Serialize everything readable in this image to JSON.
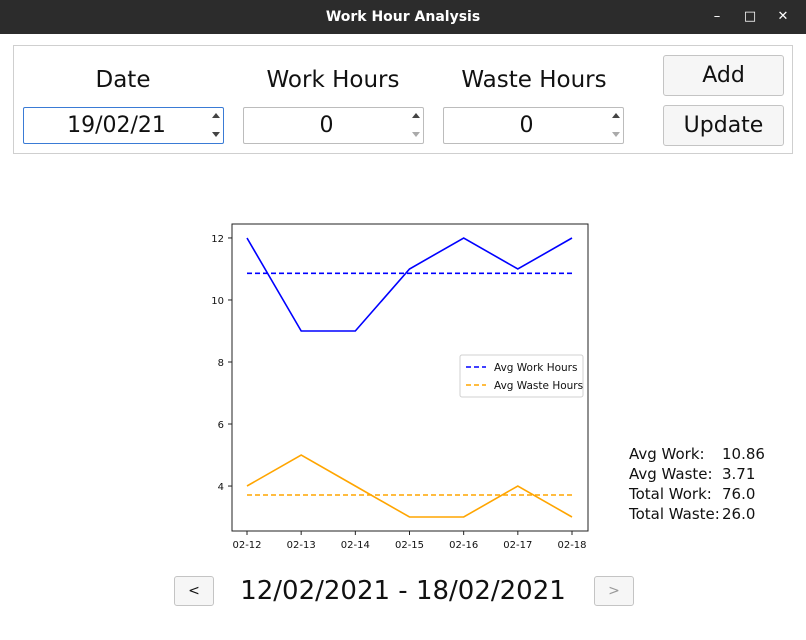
{
  "window": {
    "title": "Work Hour Analysis",
    "minimize": "–",
    "maximize": "□",
    "close": "✕"
  },
  "form": {
    "date_label": "Date",
    "work_label": "Work Hours",
    "waste_label": "Waste Hours",
    "date_value": "19/02/21",
    "work_value": "0",
    "waste_value": "0",
    "add_label": "Add",
    "update_label": "Update"
  },
  "chart_data": {
    "type": "line",
    "categories": [
      "02-12",
      "02-13",
      "02-14",
      "02-15",
      "02-16",
      "02-17",
      "02-18"
    ],
    "series": [
      {
        "name": "",
        "color": "#0000ff",
        "style": "solid",
        "values": [
          12,
          9,
          9,
          11,
          12,
          11,
          12
        ]
      },
      {
        "name": "",
        "color": "#ffa500",
        "style": "solid",
        "values": [
          4,
          5,
          4,
          3,
          3,
          4,
          3
        ]
      },
      {
        "name": "Avg Work Hours",
        "color": "#0000ff",
        "style": "dashed",
        "values": [
          10.86,
          10.86,
          10.86,
          10.86,
          10.86,
          10.86,
          10.86
        ]
      },
      {
        "name": "Avg Waste Hours",
        "color": "#ffa500",
        "style": "dashed",
        "values": [
          3.71,
          3.71,
          3.71,
          3.71,
          3.71,
          3.71,
          3.71
        ]
      }
    ],
    "yticks": [
      "4",
      "6",
      "8",
      "10",
      "12"
    ],
    "ylim": [
      2.55,
      12.45
    ],
    "legend": "center-right",
    "grid": false,
    "title": "",
    "xlabel": "",
    "ylabel": ""
  },
  "stats": [
    {
      "key": "Avg Work:",
      "value": "10.86"
    },
    {
      "key": "Avg Waste:",
      "value": "3.71"
    },
    {
      "key": "Total Work:",
      "value": "76.0"
    },
    {
      "key": "Total Waste:",
      "value": "26.0"
    }
  ],
  "nav": {
    "prev": "<",
    "next": ">",
    "range": "12/02/2021 - 18/02/2021"
  }
}
